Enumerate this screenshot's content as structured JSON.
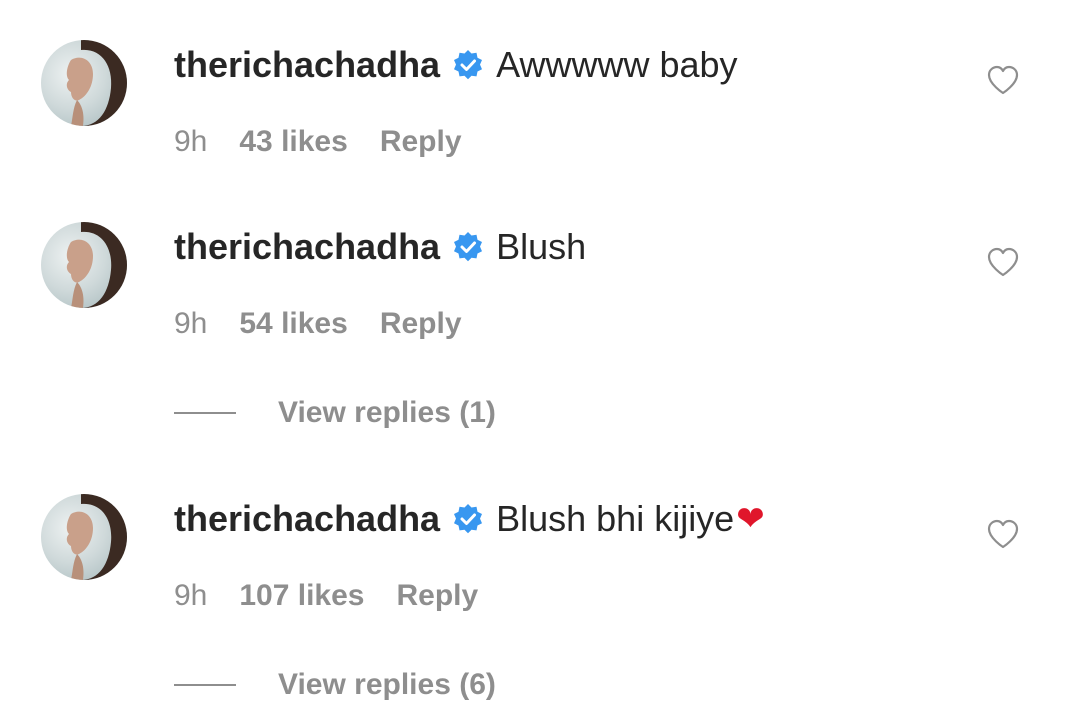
{
  "comments": [
    {
      "username": "therichachadha",
      "text": "Awwwww baby",
      "emoji": "",
      "time": "9h",
      "likes": "43 likes",
      "reply_label": "Reply",
      "view_replies": ""
    },
    {
      "username": "therichachadha",
      "text": "Blush",
      "emoji": "",
      "time": "9h",
      "likes": "54 likes",
      "reply_label": "Reply",
      "view_replies": "View replies (1)"
    },
    {
      "username": "therichachadha",
      "text": "Blush bhi kijiye",
      "emoji": "❤",
      "time": "9h",
      "likes": "107 likes",
      "reply_label": "Reply",
      "view_replies": "View replies (6)"
    }
  ],
  "icons": {
    "verified": "verified-badge-icon",
    "like": "heart-outline-icon",
    "avatar": "profile-photo"
  },
  "colors": {
    "verified_blue": "#3897f0",
    "meta_gray": "#8e8e8e",
    "text_dark": "#262626",
    "heart_red": "#e0162b"
  }
}
